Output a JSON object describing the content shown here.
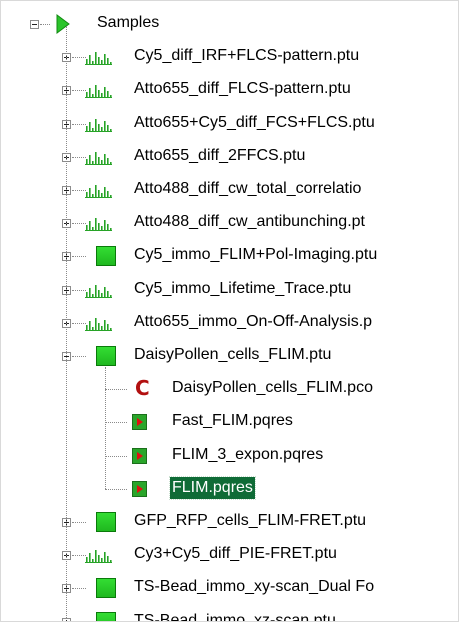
{
  "tree": {
    "root": {
      "label": "Samples",
      "icon": "green-play-icon",
      "expanded": true
    },
    "items": [
      {
        "label": "Cy5_diff_IRF+FLCS-pattern.ptu",
        "icon": "histogram-icon",
        "expanded": false
      },
      {
        "label": "Atto655_diff_FLCS-pattern.ptu",
        "icon": "histogram-icon",
        "expanded": false
      },
      {
        "label": "Atto655+Cy5_diff_FCS+FLCS.ptu",
        "icon": "histogram-icon",
        "expanded": false
      },
      {
        "label": "Atto655_diff_2FFCS.ptu",
        "icon": "histogram-icon",
        "expanded": false
      },
      {
        "label": "Atto488_diff_cw_total_correlatio",
        "icon": "histogram-icon",
        "expanded": false
      },
      {
        "label": "Atto488_diff_cw_antibunching.pt",
        "icon": "histogram-icon",
        "expanded": false
      },
      {
        "label": "Cy5_immo_FLIM+Pol-Imaging.ptu",
        "icon": "green-square-icon",
        "expanded": false
      },
      {
        "label": "Cy5_immo_Lifetime_Trace.ptu",
        "icon": "histogram-icon",
        "expanded": false
      },
      {
        "label": "Atto655_immo_On-Off-Analysis.p",
        "icon": "histogram-icon",
        "expanded": false
      },
      {
        "label": "DaisyPollen_cells_FLIM.ptu",
        "icon": "green-square-icon",
        "expanded": true
      },
      {
        "label": "GFP_RFP_cells_FLIM-FRET.ptu",
        "icon": "green-square-icon",
        "expanded": false
      },
      {
        "label": "Cy3+Cy5_diff_PIE-FRET.ptu",
        "icon": "histogram-icon",
        "expanded": false
      },
      {
        "label": "TS-Bead_immo_xy-scan_Dual Fo",
        "icon": "green-square-icon",
        "expanded": false
      },
      {
        "label": "TS-Bead_immo_xz-scan.ptu",
        "icon": "green-square-icon",
        "expanded": false
      }
    ],
    "children": [
      {
        "label": "DaisyPollen_cells_FLIM.pco",
        "icon": "pco-c-icon"
      },
      {
        "label": "Fast_FLIM.pqres",
        "icon": "result-play-icon"
      },
      {
        "label": "FLIM_3_expon.pqres",
        "icon": "result-play-icon"
      },
      {
        "label": "FLIM.pqres",
        "icon": "result-play-icon",
        "selected": true
      }
    ]
  },
  "colors": {
    "selection": "#0f6b36",
    "histogram": "#27a327",
    "square": "#22c222",
    "pco": "#b21010"
  }
}
